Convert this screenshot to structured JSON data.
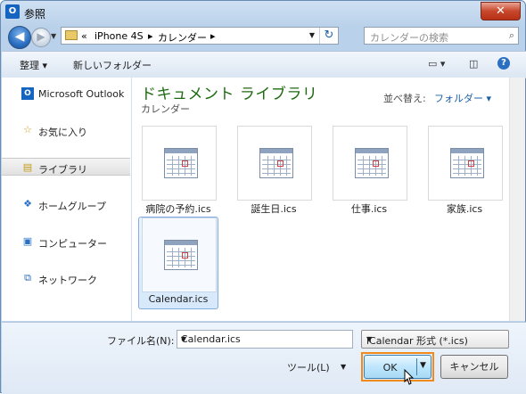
{
  "window": {
    "title": "参照",
    "app_icon": "O",
    "close_glyph": "✕"
  },
  "nav": {
    "back_glyph": "◀",
    "forward_glyph": "▶",
    "breadcrumb": [
      "«",
      "iPhone 4S",
      "▸",
      "カレンダー",
      "▸"
    ],
    "search_placeholder": "カレンダーの検索"
  },
  "toolbar": {
    "organize": "整理 ▾",
    "new_folder": "新しいフォルダー"
  },
  "sidebar": {
    "items": [
      {
        "label": "Microsoft Outlook",
        "icon": "outlook-icon",
        "glyph": "O"
      },
      {
        "label": "お気に入り",
        "icon": "favorites-star-icon",
        "glyph": "☆"
      },
      {
        "label": "ライブラリ",
        "icon": "library-icon",
        "glyph": "▤"
      },
      {
        "label": "ホームグループ",
        "icon": "homegroup-icon",
        "glyph": "❖"
      },
      {
        "label": "コンピューター",
        "icon": "computer-icon",
        "glyph": "▣"
      },
      {
        "label": "ネットワーク",
        "icon": "network-icon",
        "glyph": "⧉"
      }
    ]
  },
  "main": {
    "library_title": "ドキュメント ライブラリ",
    "library_subtitle": "カレンダー",
    "arrange_label": "並べ替え:",
    "arrange_value": "フォルダー ▾",
    "files": [
      {
        "name": "病院の予約.ics"
      },
      {
        "name": "誕生日.ics"
      },
      {
        "name": "仕事.ics"
      },
      {
        "name": "家族.ics"
      },
      {
        "name": "Calendar.ics"
      }
    ]
  },
  "footer": {
    "filename_label": "ファイル名(N):",
    "filename_value": "Calendar.ics",
    "filetype": "iCalendar 形式 (*.ics)",
    "tools": "ツール(L)",
    "ok": "OK",
    "cancel": "キャンセル"
  },
  "colors": {
    "accent": "#f08a1c",
    "library_title": "#1e6a10",
    "link": "#1b5fa8"
  }
}
